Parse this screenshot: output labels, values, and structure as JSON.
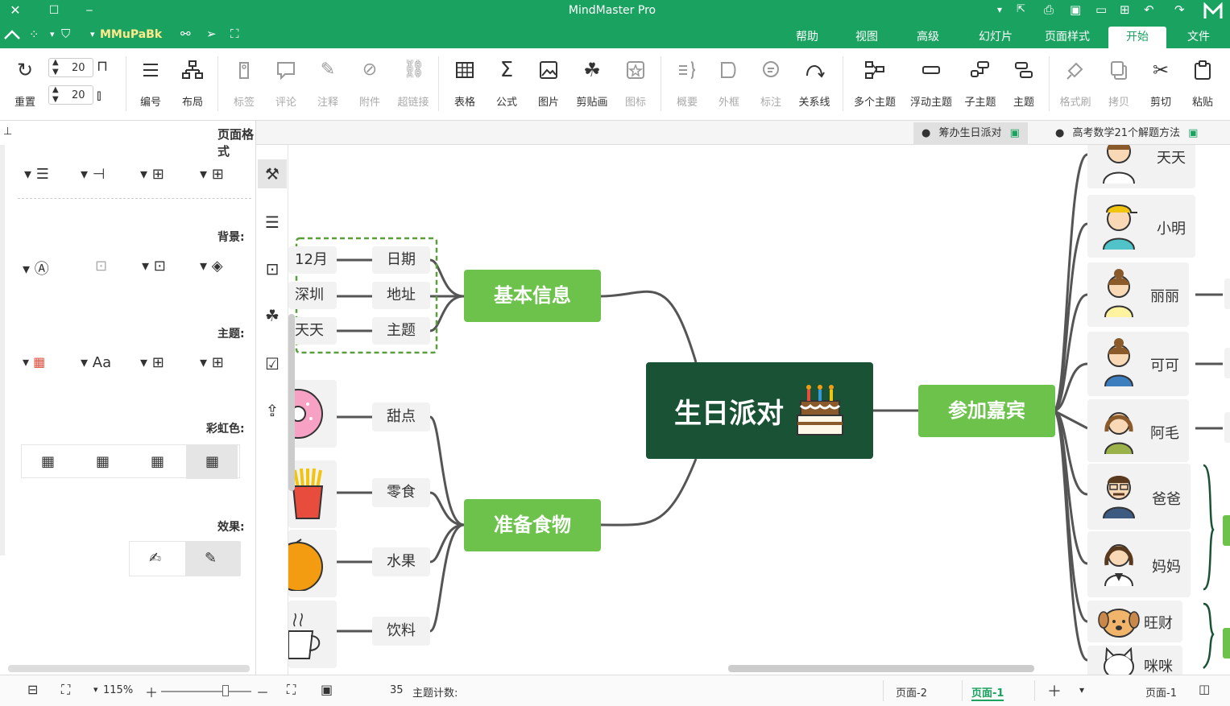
{
  "titlebar": {
    "title": "MindMaster Pro"
  },
  "tabs": [
    {
      "label": "文件",
      "active": false
    },
    {
      "label": "开始",
      "active": true
    },
    {
      "label": "页面样式",
      "active": false
    },
    {
      "label": "幻灯片",
      "active": false
    },
    {
      "label": "高级",
      "active": false
    },
    {
      "label": "视图",
      "active": false
    },
    {
      "label": "帮助",
      "active": false
    }
  ],
  "user": {
    "name": "MMuPaBk"
  },
  "ribbon": {
    "paste": "粘贴",
    "cut": "剪切",
    "copy": "拷贝",
    "format_painter": "格式刷",
    "topic": "主题",
    "subtopic": "子主题",
    "floating_topic": "浮动主题",
    "multiple_topics": "多个主题",
    "relationship": "关系线",
    "callout": "标注",
    "boundary": "外框",
    "summary": "概要",
    "icon": "图标",
    "clipart": "剪贴画",
    "image": "图片",
    "formula": "公式",
    "table": "表格",
    "hyperlink": "超链接",
    "attachment": "附件",
    "note": "注释",
    "comment": "评论",
    "tag": "标签",
    "layout": "布局",
    "numbering": "编号",
    "spacing_h": "20",
    "spacing_v": "20",
    "reset": "重置"
  },
  "doctabs": [
    {
      "label": "高考数学21个解题方法"
    },
    {
      "label": "筹办生日派对"
    }
  ],
  "panel": {
    "title": "页面格式",
    "background_label": "背景:",
    "theme_label": "主题:",
    "rainbow_label": "彩虹色:",
    "effect_label": "效果:"
  },
  "mindmap": {
    "central": "生日派对",
    "branches": {
      "basic_info": "基本信息",
      "food": "准备食物",
      "guests": "参加嘉宾"
    },
    "basic_items": [
      {
        "label": "日期",
        "value": "12月"
      },
      {
        "label": "地址",
        "value": "深圳"
      },
      {
        "label": "主题",
        "value": "天天"
      }
    ],
    "food_items": [
      "甜点",
      "零食",
      "水果",
      "饮料"
    ],
    "guests": [
      "天天",
      "小明",
      "丽丽",
      "可可",
      "阿毛",
      "爸爸",
      "妈妈",
      "旺财",
      "咪咪"
    ]
  },
  "status": {
    "topic_count_label": "主题计数:",
    "topic_count": "35",
    "zoom": "115%",
    "pages": [
      "页面-1",
      "页面-2"
    ],
    "active_page": "页面-1",
    "page_selector": "页面-1"
  },
  "colors": {
    "brand": "#1aa260",
    "branch": "#6cc24a",
    "central": "#1a5235"
  }
}
